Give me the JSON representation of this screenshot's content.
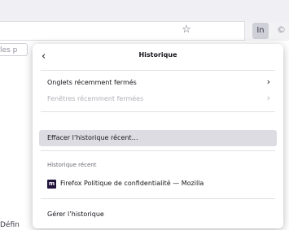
{
  "page_fragments": {
    "top_left": "les p",
    "bottom_left": "Défin"
  },
  "toolbar": {
    "star_icon": "star-icon",
    "library_label": "In",
    "edge_glyph": "©"
  },
  "history_panel": {
    "back_icon": "‹",
    "title": "Historique",
    "items": {
      "recently_closed_tabs": "Onglets récemment fermés",
      "recently_closed_windows": "Fenêtres récemment fermées",
      "clear_recent_history": "Effacer l’historique récent…",
      "recent_history_header": "Historique récent",
      "recent_entry": "Firefox Politique de confidentialité — Mozilla",
      "manage_history": "Gérer l’historique"
    },
    "recent_entry_favicon": "m",
    "chevron": "›"
  }
}
